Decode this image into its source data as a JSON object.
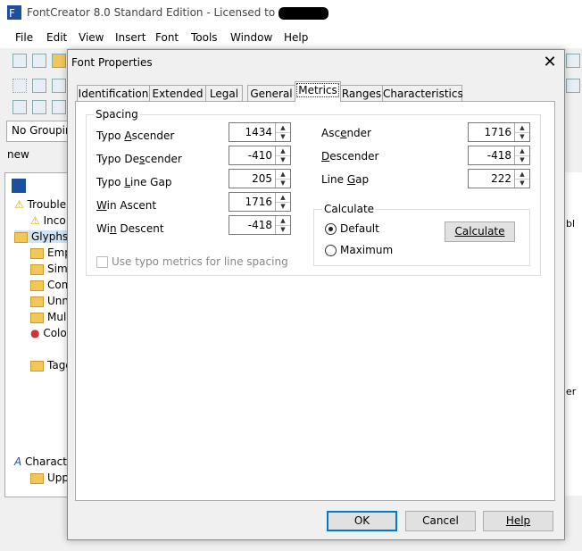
{
  "app": {
    "title": "FontCreator 8.0 Standard Edition - Licensed to",
    "menus": [
      "File",
      "Edit",
      "View",
      "Insert",
      "Font",
      "Tools",
      "Window",
      "Help"
    ],
    "grouping": "No Groupin",
    "doc_tab": "new",
    "left_tree": [
      "Trouble",
      "Inco",
      "Glyphs",
      "Emp",
      "Sim",
      "Com",
      "Unn",
      "Mul",
      "Colo",
      "Tagg",
      "Charact",
      "Upp"
    ],
    "right_labels": [
      "bl",
      "er"
    ]
  },
  "dialog": {
    "title": "Font Properties",
    "tabs": [
      "Identification",
      "Extended",
      "Legal",
      "General",
      "Metrics",
      "Ranges",
      "Characteristics"
    ],
    "active_tab": "Metrics",
    "spacing_label": "Spacing",
    "left_fields": [
      {
        "label": "Typo Ascender",
        "value": "1434"
      },
      {
        "label": "Typo Descender",
        "value": "-410"
      },
      {
        "label": "Typo Line Gap",
        "value": "205"
      },
      {
        "label": "Win Ascent",
        "value": "1716"
      },
      {
        "label": "Win Descent",
        "value": "-418"
      }
    ],
    "right_fields": [
      {
        "label": "Ascender",
        "value": "1716"
      },
      {
        "label": "Descender",
        "value": "-418"
      },
      {
        "label": "Line Gap",
        "value": "222"
      }
    ],
    "calculate_label": "Calculate",
    "radio_default": "Default",
    "radio_maximum": "Maximum",
    "calculate_button": "Calculate",
    "checkbox_label": "Use typo metrics for line spacing",
    "ok": "OK",
    "cancel": "Cancel",
    "help": "Help"
  }
}
